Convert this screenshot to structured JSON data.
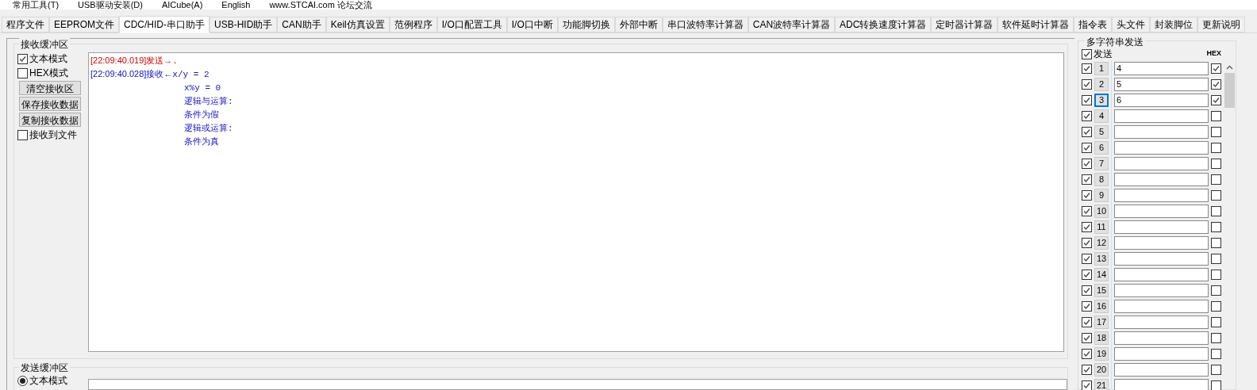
{
  "menu": [
    "常用工具(T)",
    "USB驱动安装(D)",
    "AICube(A)",
    "English",
    "www.STCAI.com 论坛交流"
  ],
  "tabs": [
    {
      "label": "程序文件",
      "selected": false
    },
    {
      "label": "EEPROM文件",
      "selected": false
    },
    {
      "label": "CDC/HID-串口助手",
      "selected": true
    },
    {
      "label": "USB-HID助手",
      "selected": false
    },
    {
      "label": "CAN助手",
      "selected": false
    },
    {
      "label": "Keil仿真设置",
      "selected": false
    },
    {
      "label": "范例程序",
      "selected": false
    },
    {
      "label": "I/O口配置工具",
      "selected": false
    },
    {
      "label": "I/O口中断",
      "selected": false
    },
    {
      "label": "功能脚切换",
      "selected": false
    },
    {
      "label": "外部中断",
      "selected": false
    },
    {
      "label": "串口波特率计算器",
      "selected": false
    },
    {
      "label": "CAN波特率计算器",
      "selected": false
    },
    {
      "label": "ADC转换速度计算器",
      "selected": false
    },
    {
      "label": "定时器计算器",
      "selected": false
    },
    {
      "label": "软件延时计算器",
      "selected": false
    },
    {
      "label": "指令表",
      "selected": false
    },
    {
      "label": "头文件",
      "selected": false
    },
    {
      "label": "封装脚位",
      "selected": false
    },
    {
      "label": "更新说明",
      "selected": false
    }
  ],
  "receive": {
    "title": "接收缓冲区",
    "controls": [
      {
        "kind": "checkbox",
        "label": "文本模式",
        "checked": true
      },
      {
        "kind": "checkbox",
        "label": "HEX模式",
        "checked": false
      },
      {
        "kind": "button",
        "label": "清空接收区"
      },
      {
        "kind": "button",
        "label": "保存接收数据"
      },
      {
        "kind": "button",
        "label": "复制接收数据"
      },
      {
        "kind": "checkbox",
        "label": "接收到文件",
        "checked": false
      }
    ],
    "lines": [
      {
        "kind": "sent",
        "stamp": "[22:09:40.019]发送→",
        "text": "."
      },
      {
        "kind": "received",
        "stamp": "[22:09:40.028]接收←",
        "text": "x/y = 2"
      },
      {
        "kind": "continued",
        "text": "x%y = 0"
      },
      {
        "kind": "continued",
        "text": "逻辑与运算:"
      },
      {
        "kind": "continued",
        "text": "条件为假"
      },
      {
        "kind": "continued",
        "text": "逻辑或运算:"
      },
      {
        "kind": "continued",
        "text": "条件为真"
      }
    ]
  },
  "send": {
    "title": "发送缓冲区",
    "modes": [
      {
        "label": "文本模式",
        "selected": true
      }
    ]
  },
  "multi_send": {
    "title": "多字符串发送",
    "header_label": "发送",
    "header_checked": true,
    "hex_label": "HEX",
    "rows": [
      {
        "number": "1",
        "enabled": true,
        "value": "4",
        "hex": true,
        "focused": false
      },
      {
        "number": "2",
        "enabled": true,
        "value": "5",
        "hex": true,
        "focused": false
      },
      {
        "number": "3",
        "enabled": true,
        "value": "6",
        "hex": true,
        "focused": true
      },
      {
        "number": "4",
        "enabled": true,
        "hex": false,
        "focused": false
      },
      {
        "number": "5",
        "enabled": true,
        "hex": false,
        "focused": false
      },
      {
        "number": "6",
        "enabled": true,
        "hex": false,
        "focused": false
      },
      {
        "number": "7",
        "enabled": true,
        "hex": false,
        "focused": false
      },
      {
        "number": "8",
        "enabled": true,
        "hex": false,
        "focused": false
      },
      {
        "number": "9",
        "enabled": true,
        "hex": false,
        "focused": false
      },
      {
        "number": "10",
        "enabled": true,
        "hex": false,
        "focused": false
      },
      {
        "number": "11",
        "enabled": true,
        "hex": false,
        "focused": false
      },
      {
        "number": "12",
        "enabled": true,
        "hex": false,
        "focused": false
      },
      {
        "number": "13",
        "enabled": true,
        "hex": false,
        "focused": false
      },
      {
        "number": "14",
        "enabled": true,
        "hex": false,
        "focused": false
      },
      {
        "number": "15",
        "enabled": true,
        "hex": false,
        "focused": false
      },
      {
        "number": "16",
        "enabled": true,
        "hex": false,
        "focused": false
      },
      {
        "number": "17",
        "enabled": true,
        "hex": false,
        "focused": false
      },
      {
        "number": "18",
        "enabled": true,
        "hex": false,
        "focused": false
      },
      {
        "number": "19",
        "enabled": true,
        "hex": false,
        "focused": false
      },
      {
        "number": "20",
        "enabled": true,
        "hex": false,
        "focused": false
      },
      {
        "number": "21",
        "enabled": true,
        "hex": false,
        "focused": false
      }
    ]
  }
}
